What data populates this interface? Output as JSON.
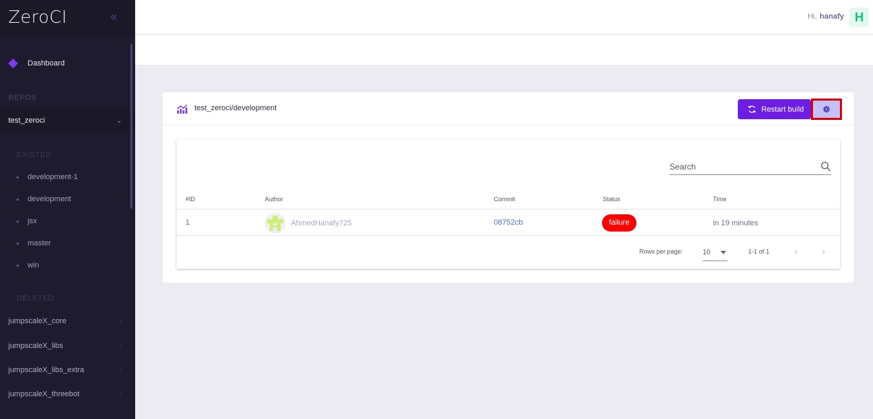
{
  "app": {
    "logo": "ZeroCI"
  },
  "sidebar": {
    "collapse_icon": "double-chevron-left",
    "dashboard_label": "Dashboard",
    "repos_title": "REPOS",
    "open_repo": "test_zeroci",
    "existed_title": "EXISTED",
    "existed_branches": [
      "development-1",
      "development",
      "jsx",
      "master",
      "win"
    ],
    "deleted_title": "DELETED",
    "repos": [
      "jumpscaleX_core",
      "jumpscaleX_libs",
      "jumpscaleX_libs_extra",
      "jumpscaleX_threebot"
    ]
  },
  "topbar": {
    "greeting": "Hi,",
    "username": "hanafy",
    "avatar_letter": "H"
  },
  "card": {
    "title": "test_zeroci/development",
    "restart_label": "Restart build",
    "settings_icon": "gear-icon",
    "search_placeholder": "Search",
    "columns": [
      "#ID",
      "Author",
      "Commit",
      "Status",
      "Time"
    ],
    "rows": [
      {
        "id": "1",
        "author": "AhmedHanafy725",
        "commit": "08752cb",
        "status": "failure",
        "time": "in 19 minutes"
      }
    ],
    "rows_per_page_label": "Rows per page:",
    "rows_per_page_value": "10",
    "range": "1-1 of 1"
  },
  "colors": {
    "accent": "#6e1ee2",
    "failure": "#fb0000",
    "sidebar_bg": "#1f1b2e",
    "highlight_border": "#e00000"
  }
}
